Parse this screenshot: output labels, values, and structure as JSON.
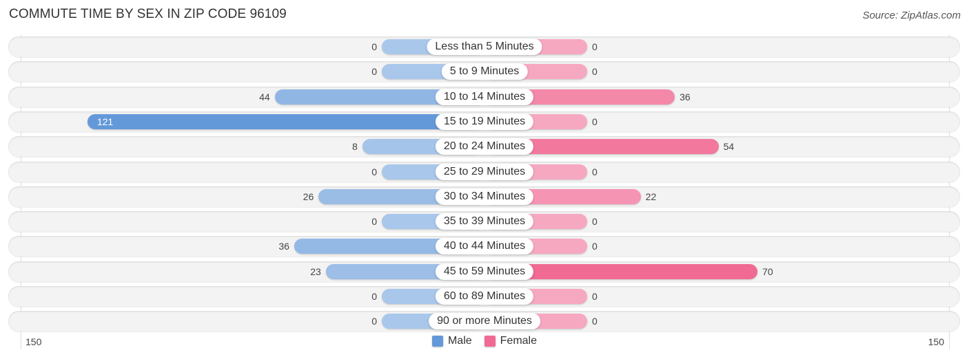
{
  "header": {
    "title": "COMMUTE TIME BY SEX IN ZIP CODE 96109",
    "source": "Source: ZipAtlas.com"
  },
  "colors": {
    "male": "#6399d9",
    "male_light": "#a9c7ea",
    "female": "#f06a93",
    "female_light": "#f7a8c1"
  },
  "chart_data": {
    "type": "bar",
    "orientation": "horizontal-diverging",
    "title": "COMMUTE TIME BY SEX IN ZIP CODE 96109",
    "categories": [
      "Less than 5 Minutes",
      "5 to 9 Minutes",
      "10 to 14 Minutes",
      "15 to 19 Minutes",
      "20 to 24 Minutes",
      "25 to 29 Minutes",
      "30 to 34 Minutes",
      "35 to 39 Minutes",
      "40 to 44 Minutes",
      "45 to 59 Minutes",
      "60 to 89 Minutes",
      "90 or more Minutes"
    ],
    "series": [
      {
        "name": "Male",
        "values": [
          0,
          0,
          44,
          121,
          8,
          0,
          26,
          0,
          36,
          23,
          0,
          0
        ]
      },
      {
        "name": "Female",
        "values": [
          0,
          0,
          36,
          0,
          54,
          0,
          22,
          0,
          0,
          70,
          0,
          0
        ]
      }
    ],
    "axis": {
      "left_tick": "150",
      "right_tick": "150",
      "range": [
        0,
        150
      ]
    },
    "legend": {
      "position": "bottom-center",
      "items": [
        "Male",
        "Female"
      ]
    }
  }
}
